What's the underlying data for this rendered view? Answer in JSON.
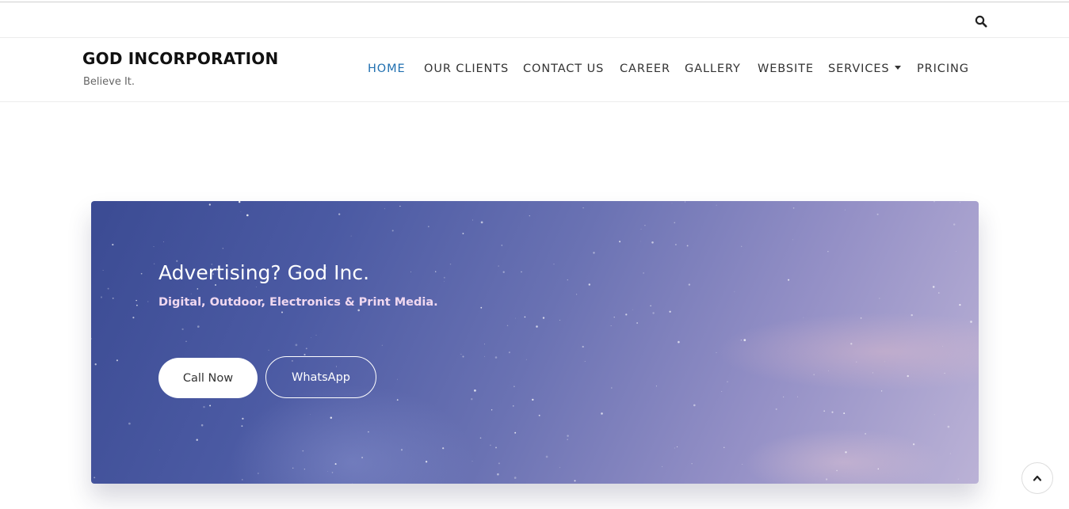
{
  "topbar": {
    "search_icon": "search-icon"
  },
  "brand": {
    "name": "GOD INCORPORATION",
    "tagline": "Believe It."
  },
  "nav": {
    "items": [
      {
        "label": "HOME",
        "active": true
      },
      {
        "label": "OUR CLIENTS",
        "active": false
      },
      {
        "label": "CONTACT US",
        "active": false
      },
      {
        "label": "CAREER",
        "active": false
      },
      {
        "label": "GALLERY",
        "active": false
      },
      {
        "label": "WEBSITE",
        "active": false
      },
      {
        "label": "SERVICES",
        "active": false,
        "has_dropdown": true
      },
      {
        "label": "PRICING",
        "active": false
      }
    ]
  },
  "hero": {
    "title": "Advertising? God Inc.",
    "subtitle": "Digital, Outdoor, Electronics & Print Media.",
    "primary_button": "Call Now",
    "secondary_button": "WhatsApp"
  },
  "scroll_top": {
    "icon": "chevron-up-icon"
  },
  "colors": {
    "accent": "#1f6fb0",
    "hero_start": "#3b4b93",
    "hero_end": "#bbb2d6",
    "subtitle": "#f0d8f0"
  }
}
